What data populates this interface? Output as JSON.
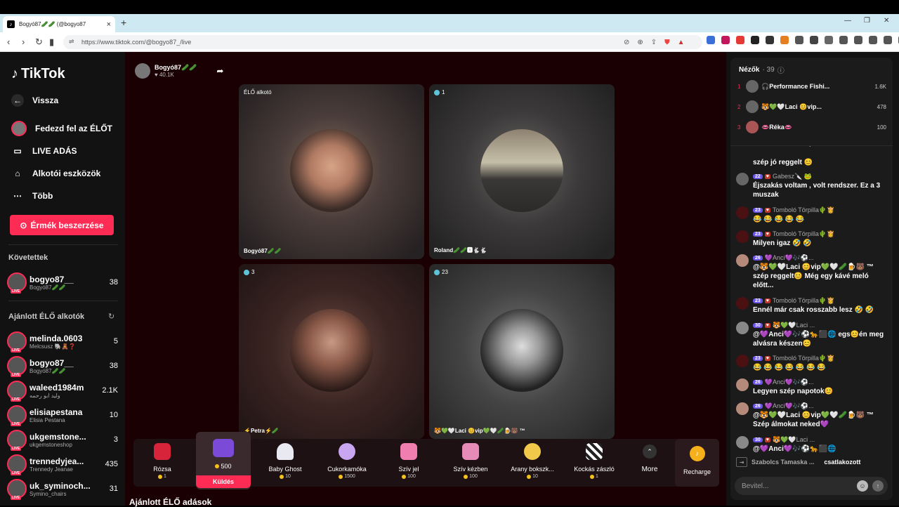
{
  "browser": {
    "tab_title": "Bogyó87🥒🥒 (@bogyo87",
    "url": "https://www.tiktok.com/@bogyo87_/live"
  },
  "sidebar": {
    "logo": "TikTok",
    "back": "Vissza",
    "nav": [
      "Fedezd fel az ÉLŐT",
      "LIVE ADÁS",
      "Alkotói eszközök",
      "Több"
    ],
    "coins_button": "Érmék beszerzése",
    "following_title": "Követettek",
    "following": [
      {
        "name": "bogyo87__",
        "sub": "Bogyó87🥒🥒",
        "count": "38"
      }
    ],
    "recommended_title": "Ajánlott ÉLŐ alkotók",
    "recommended": [
      {
        "name": "melinda.0603",
        "sub": "Melcsusz 🐘🧸❓",
        "count": "5"
      },
      {
        "name": "bogyo87__",
        "sub": "Bogyó87🥒🥒",
        "count": "38"
      },
      {
        "name": "waleed1984m",
        "sub": "وليد ابو رحمه",
        "count": "2.1K"
      },
      {
        "name": "elisiapestana",
        "sub": "Elisia Pestana",
        "count": "10"
      },
      {
        "name": "ukgemstone...",
        "sub": "ukgemstoneshop",
        "count": "3"
      },
      {
        "name": "trennedyjea...",
        "sub": "Trennedy Jeanae",
        "count": "435"
      },
      {
        "name": "uk_syminoch...",
        "sub": "Symino_chairs",
        "count": "31"
      }
    ]
  },
  "host": {
    "name": "Bogyó87🥒🥒",
    "likes": "♥ 40.1K"
  },
  "stage": {
    "cells": [
      {
        "tag": "ÉLŐ alkotó",
        "name": "Bogyó87🥒🥒"
      },
      {
        "tag": "1",
        "name": "Roland🥒🥒🆇🐇🐇"
      },
      {
        "tag": "3",
        "name": "⚡Petra⚡🥒"
      },
      {
        "tag": "23",
        "name": "🐯💚🤍Laci 😊vip💚🤍🥒🍺🐻 ™"
      }
    ]
  },
  "gifts": [
    {
      "name": "Rózsa",
      "price": "1"
    },
    {
      "name": "",
      "price": "500"
    },
    {
      "name": "Baby Ghost",
      "price": "10"
    },
    {
      "name": "Cukorkamóka",
      "price": "1500"
    },
    {
      "name": "Szív jel",
      "price": "100"
    },
    {
      "name": "Szív kézben",
      "price": "100"
    },
    {
      "name": "Arany bokszk...",
      "price": "10"
    },
    {
      "name": "Kockás zászló",
      "price": "1"
    }
  ],
  "send_label": "Küldés",
  "more_label": "More",
  "recharge_label": "Recharge",
  "bottom_title": "Ajánlott ÉLŐ adások",
  "chat": {
    "viewers_title": "Nézők",
    "viewers_count": "· 39",
    "top_viewers": [
      {
        "rank": "1",
        "name": "🎧Performance Fishi...",
        "score": "1.6K"
      },
      {
        "rank": "2",
        "name": "🐯💚🤍Laci 😊vip...",
        "score": "478"
      },
      {
        "rank": "3",
        "name": "👄Réka👄",
        "score": "100"
      }
    ],
    "messages": [
      {
        "level": "",
        "user": "",
        "text": "szép jó reggelt 😊"
      },
      {
        "level": "22",
        "user": "Gabesz🔪 🐸",
        "text": "Éjszakás voltam , volt rendszer. Ez a 3 muszak"
      },
      {
        "level": "23",
        "user": "Tomboló Törpilla🌵👸",
        "text": "😂 😂 😂 😂 😂"
      },
      {
        "level": "23",
        "user": "Tomboló Törpilla🌵👸",
        "text": "Milyen igaz 🤣 🤣"
      },
      {
        "level": "26",
        "user": "💜Anci💜🎶⚽...",
        "text": "@🐯💚🤍Laci 😊vip💚🤍🥒🍺🐻 ™ szép reggelt😊 Még egy kávé meló előtt..."
      },
      {
        "level": "23",
        "user": "Tomboló Törpilla🌵👸",
        "text": "Ennél már csak rosszabb lesz 🤣 🤣"
      },
      {
        "level": "30",
        "user": "🐯💚🤍Laci ...",
        "text": "@💜Anci💜🎶⚽🐆⬛🌐 egs😊én meg alvásra készen😊"
      },
      {
        "level": "23",
        "user": "Tomboló Törpilla🌵👸",
        "text": "😂 😂 😂 😂 😂 😂 😂"
      },
      {
        "level": "26",
        "user": "💜Anci💜🎶⚽...",
        "text": "Legyen szép napotok😊"
      },
      {
        "level": "26",
        "user": "💜Anci💜🎶⚽...",
        "text": "@🐯💚🤍Laci 😊vip💚🤍🥒🍺🐻 ™ Szép álmokat neked💜"
      },
      {
        "level": "30",
        "user": "🐯💚🤍Laci ...",
        "text": "@💜Anci💜🎶⚽🐆⬛🌐"
      }
    ],
    "joined_user": "Szabolcs Tamaska ...",
    "joined_action": "csatlakozott",
    "input_placeholder": "Bevitel..."
  }
}
